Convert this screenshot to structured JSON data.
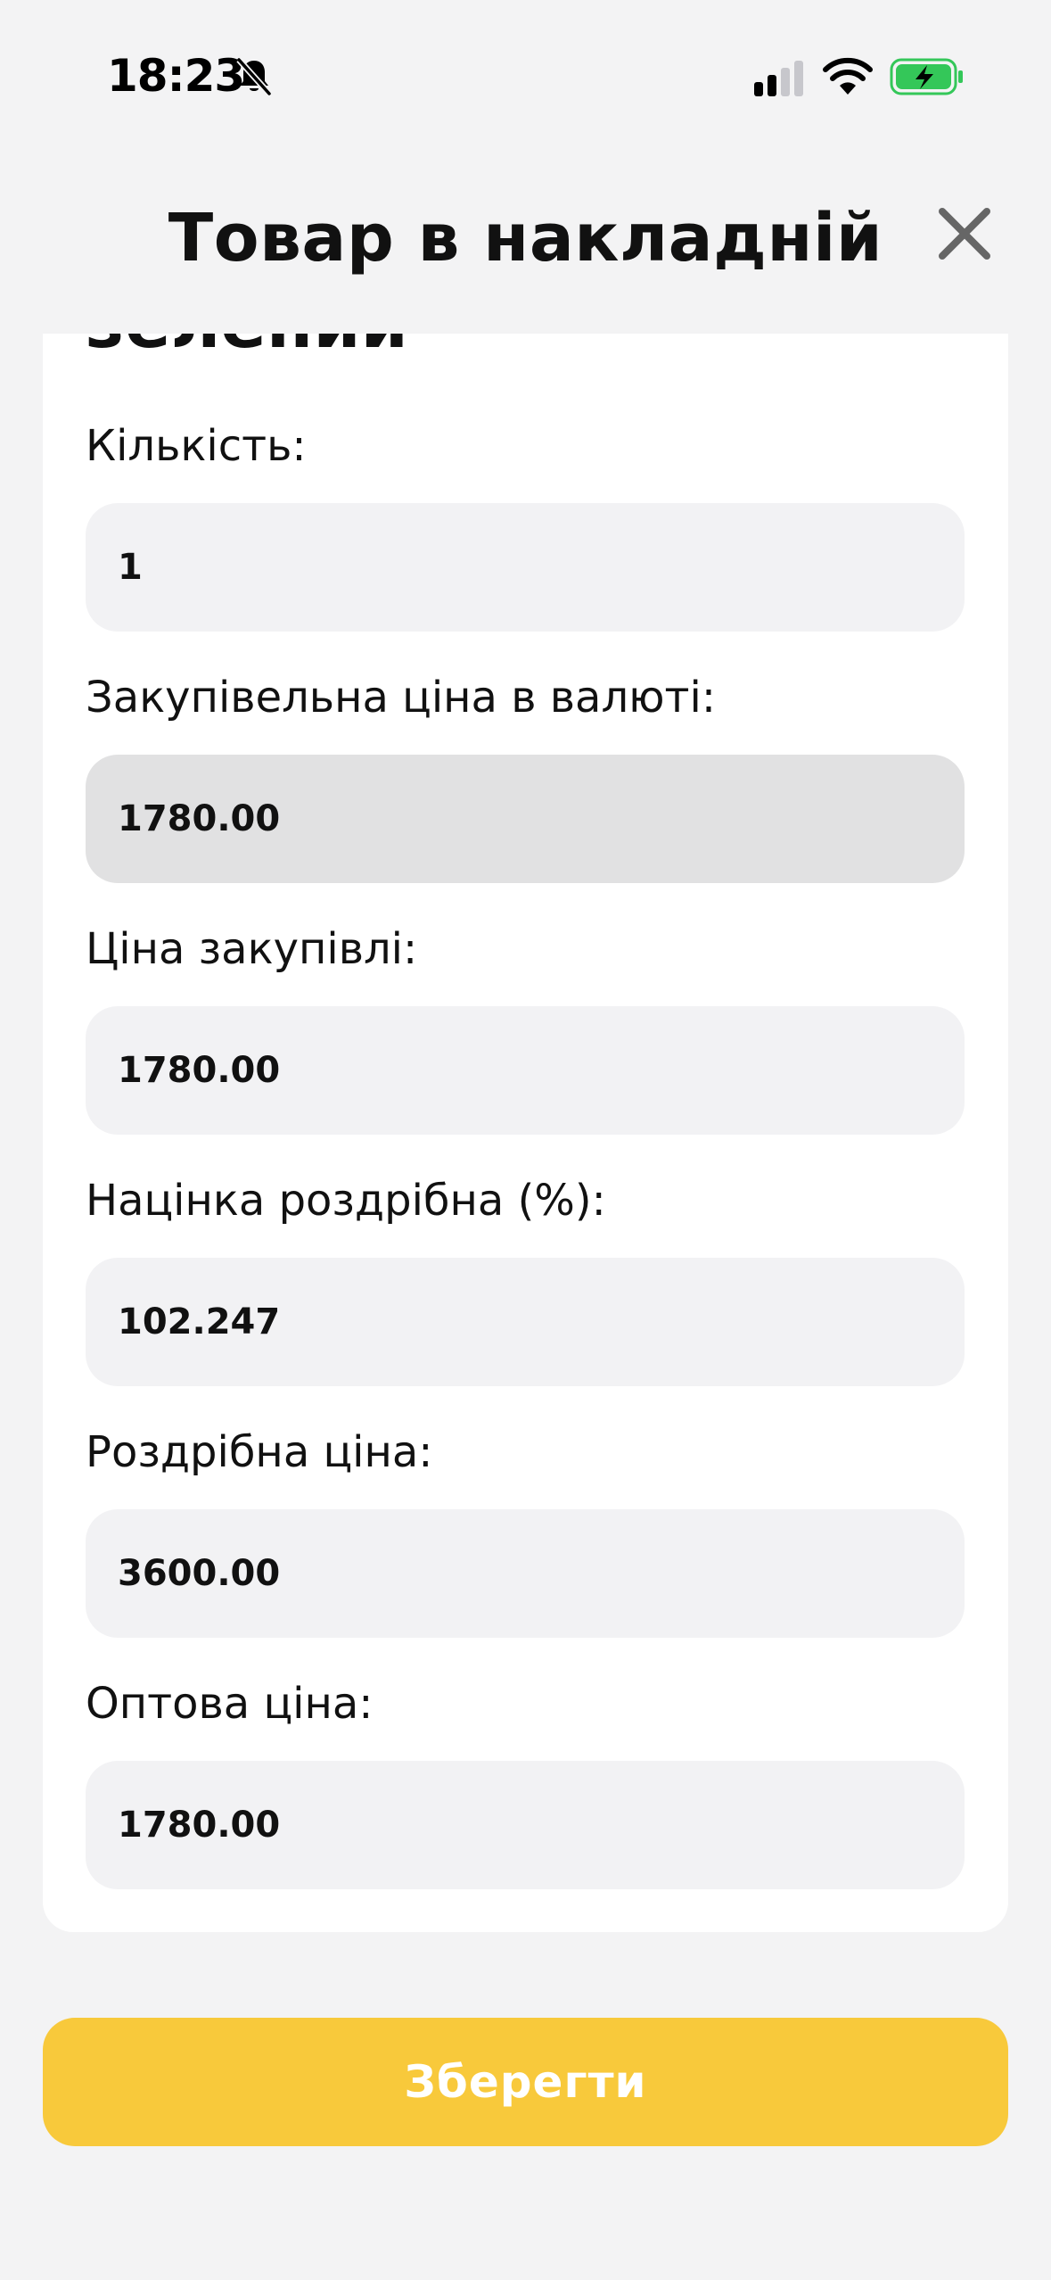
{
  "status_bar": {
    "time": "18:23",
    "mute_icon": "bell-slash-icon",
    "signal_icon": "cellular-signal-icon",
    "wifi_icon": "wifi-icon",
    "battery_icon": "battery-charging-icon",
    "battery_color": "#34c759"
  },
  "header": {
    "title": "Товар в накладній",
    "close_icon": "close-icon"
  },
  "product": {
    "name": "зелений"
  },
  "fields": [
    {
      "label": "Кількість:",
      "value": "1"
    },
    {
      "label": "Закупівельна ціна в валюті:",
      "value": "1780.00"
    },
    {
      "label": "Ціна закупівлі:",
      "value": "1780.00"
    },
    {
      "label": "Націнка роздрібна (%):",
      "value": "102.247"
    },
    {
      "label": "Роздрібна ціна:",
      "value": "3600.00"
    },
    {
      "label": "Оптова ціна:",
      "value": "1780.00"
    }
  ],
  "save_button": {
    "label": "Зберегти",
    "color": "#f8c93b"
  }
}
